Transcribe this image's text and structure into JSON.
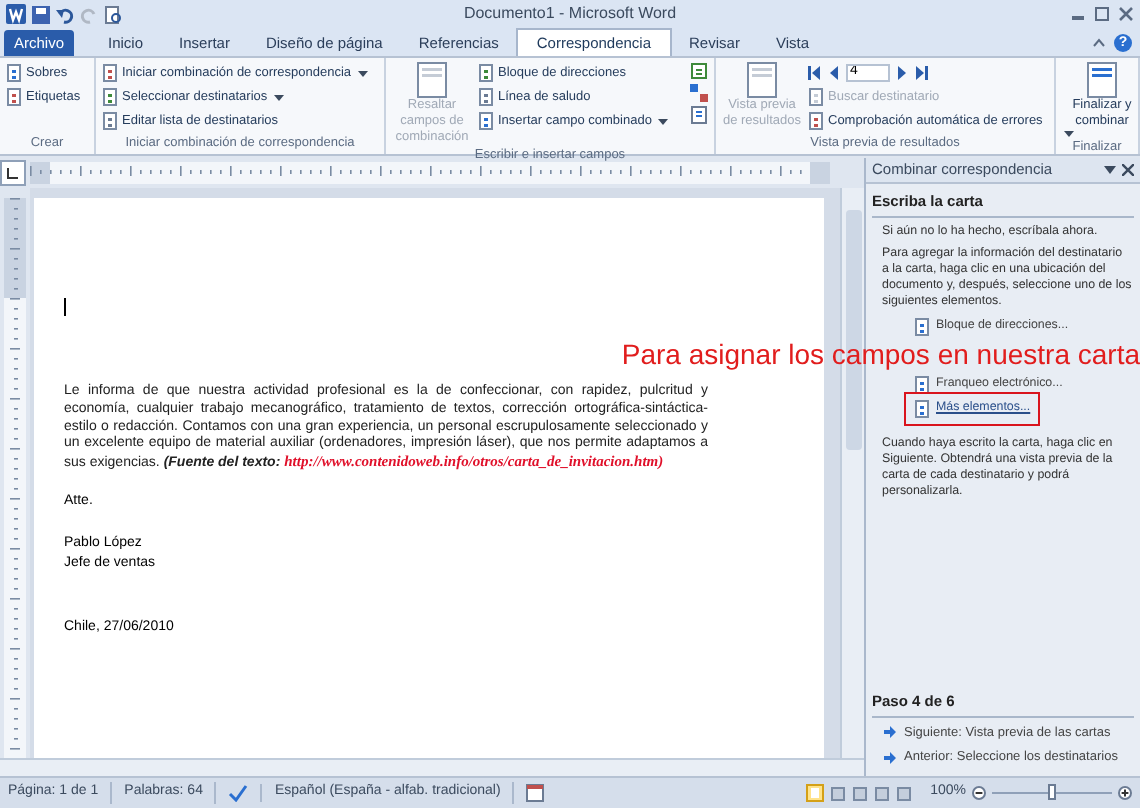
{
  "window": {
    "title": "Documento1 - Microsoft Word"
  },
  "tabs": [
    {
      "label": "Archivo",
      "kind": "file",
      "selected": false
    },
    {
      "label": "Inicio",
      "kind": "tab",
      "selected": false
    },
    {
      "label": "Insertar",
      "kind": "tab",
      "selected": false
    },
    {
      "label": "Diseño de página",
      "kind": "tab",
      "selected": false
    },
    {
      "label": "Referencias",
      "kind": "tab",
      "selected": false
    },
    {
      "label": "Correspondencia",
      "kind": "tab",
      "selected": true
    },
    {
      "label": "Revisar",
      "kind": "tab",
      "selected": false
    },
    {
      "label": "Vista",
      "kind": "tab",
      "selected": false
    }
  ],
  "help_button": "?",
  "ribbon": {
    "groups": [
      {
        "label": "Crear",
        "columns": [
          {
            "kind": "stack",
            "items": [
              {
                "label": "Sobres",
                "disabled": false,
                "dropdown": false
              },
              {
                "label": "Etiquetas",
                "disabled": false,
                "dropdown": false
              }
            ]
          }
        ]
      },
      {
        "label": "Iniciar combinación de correspondencia",
        "columns": [
          {
            "kind": "stack",
            "items": [
              {
                "label": "Iniciar combinación de correspondencia",
                "disabled": false,
                "dropdown": true
              },
              {
                "label": "Seleccionar destinatarios",
                "disabled": false,
                "dropdown": true
              },
              {
                "label": "Editar lista de destinatarios",
                "disabled": false,
                "dropdown": false
              }
            ]
          }
        ]
      },
      {
        "label": "Escribir e insertar campos",
        "columns": [
          {
            "kind": "large",
            "label": "Resaltar campos de combinación",
            "disabled": true,
            "dropdown": false
          },
          {
            "kind": "stack",
            "items": [
              {
                "label": "Bloque de direcciones",
                "disabled": false,
                "dropdown": false
              },
              {
                "label": "Línea de saludo",
                "disabled": false,
                "dropdown": false
              },
              {
                "label": "Insertar campo combinado",
                "disabled": false,
                "dropdown": true
              }
            ]
          },
          {
            "kind": "icons"
          }
        ]
      },
      {
        "label": "Vista previa de resultados",
        "columns": [
          {
            "kind": "large",
            "label": "Vista previa de resultados",
            "disabled": true,
            "dropdown": false
          },
          {
            "kind": "stack",
            "items": [
              {
                "kind": "record",
                "value": "4"
              },
              {
                "label": "Buscar destinatario",
                "disabled": true,
                "dropdown": false
              },
              {
                "label": "Comprobación automática de errores",
                "disabled": false,
                "dropdown": false
              }
            ]
          }
        ]
      },
      {
        "label": "Finalizar",
        "columns": [
          {
            "kind": "large",
            "label": "Finalizar y combinar",
            "disabled": false,
            "dropdown": true
          }
        ]
      }
    ]
  },
  "document": {
    "paragraphs": [
      {
        "kind": "cursor"
      },
      {
        "kind": "body",
        "text": "Le informa de que nuestra actividad profesional es la de confeccionar, con rapidez, pulcritud y economía, cualquier trabajo mecanográfico, tratamiento de textos, corrección ortográfica-sintáctica-estilo o redacción. Contamos con una gran experiencia, un personal escrupulosamente seleccionado y un excelente equipo de material auxiliar (ordenadores, impresión láser), que nos permite adaptamos a sus exigencias.",
        "source_label": "(Fuente del texto:",
        "source_url": "http://www.contenidoweb.info/otros/carta_de_invitacion.htm)"
      },
      {
        "kind": "line",
        "text": "Atte."
      },
      {
        "kind": "signature",
        "lines": [
          "Pablo López",
          "Jefe de ventas"
        ]
      },
      {
        "kind": "date",
        "text": "Chile, 27/06/2010"
      }
    ]
  },
  "annotation": {
    "text": "Para asignar los campos en nuestra carta"
  },
  "task_pane": {
    "title": "Combinar correspondencia",
    "heading": "Escriba la carta",
    "intro": "Si aún no lo ha hecho, escríbala ahora.",
    "instructions": "Para agregar la información del destinatario a la carta, haga clic en una ubicación del documento y, después, seleccione uno de los siguientes elementos.",
    "items": [
      {
        "label": "Bloque de direcciones...",
        "highlighted": false
      },
      {
        "kind": "hidden"
      },
      {
        "label": "Franqueo electrónico...",
        "highlighted": false
      },
      {
        "label": "Más elementos...",
        "highlighted": true
      }
    ],
    "after": "Cuando haya escrito la carta, haga clic en Siguiente. Obtendrá una vista previa de la carta de cada destinatario y podrá personalizarla.",
    "step": "Paso 4 de 6",
    "links": [
      "Siguiente: Vista previa de las cartas",
      "Anterior: Seleccione los destinatarios"
    ]
  },
  "status_bar": {
    "page": "Página: 1 de 1",
    "words": "Palabras: 64",
    "language": "Español (España - alfab. tradicional)",
    "zoom": "100%",
    "zoom_slider": {
      "level": 0.5
    }
  }
}
